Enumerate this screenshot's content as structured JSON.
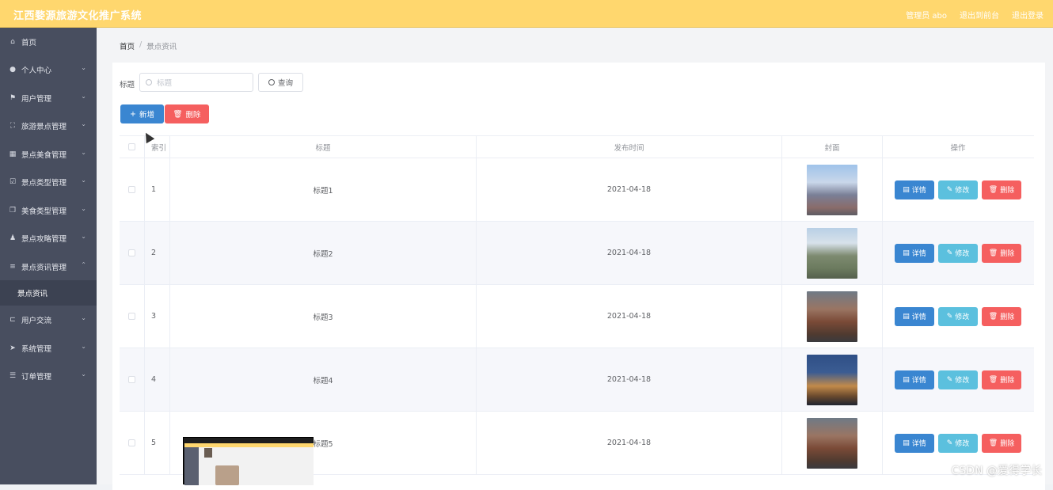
{
  "app": {
    "title": "江西婺源旅游文化推广系统",
    "links": [
      "管理员 abo",
      "退出到前台",
      "退出登录"
    ]
  },
  "sidebar": {
    "items": [
      {
        "label": "首页",
        "icon": "home-icon"
      },
      {
        "label": "个人中心",
        "icon": "user-icon"
      },
      {
        "label": "用户管理",
        "icon": "flag-icon"
      },
      {
        "label": "旅游景点管理",
        "icon": "scan-icon"
      },
      {
        "label": "景点美食管理",
        "icon": "grid-icon"
      },
      {
        "label": "景点类型管理",
        "icon": "chart-icon"
      },
      {
        "label": "美食类型管理",
        "icon": "copy-icon"
      },
      {
        "label": "景点攻略管理",
        "icon": "person-icon"
      },
      {
        "label": "景点资讯管理",
        "icon": "sliders-icon"
      },
      {
        "label": "用户交流",
        "icon": "crop-icon"
      },
      {
        "label": "系统管理",
        "icon": "send-icon"
      },
      {
        "label": "订单管理",
        "icon": "list-icon"
      }
    ],
    "subitem": "景点资讯"
  },
  "breadcrumb": [
    "首页",
    "景点资讯"
  ],
  "search": {
    "label": "标题",
    "placeholder": "标题",
    "button": "查询"
  },
  "actions": {
    "add": "新增",
    "delete": "删除"
  },
  "table": {
    "headers": [
      "索引",
      "标题",
      "发布时间",
      "封面",
      "操作"
    ],
    "rows": [
      {
        "index": "1",
        "title": "标题1",
        "date": "2021-04-18"
      },
      {
        "index": "2",
        "title": "标题2",
        "date": "2021-04-18"
      },
      {
        "index": "3",
        "title": "标题3",
        "date": "2021-04-18"
      },
      {
        "index": "4",
        "title": "标题4",
        "date": "2021-04-18"
      },
      {
        "index": "5",
        "title": "标题5",
        "date": "2021-04-18"
      }
    ],
    "op_labels": {
      "detail": "详情",
      "edit": "修改",
      "remove": "删除"
    }
  },
  "watermark": "CSDN @爱得学长",
  "colors": {
    "topbar": "#ffd76e",
    "sidebar": "#484e5f",
    "primary": "#3a86d1",
    "info": "#5bc0de",
    "danger": "#f55f5f"
  }
}
